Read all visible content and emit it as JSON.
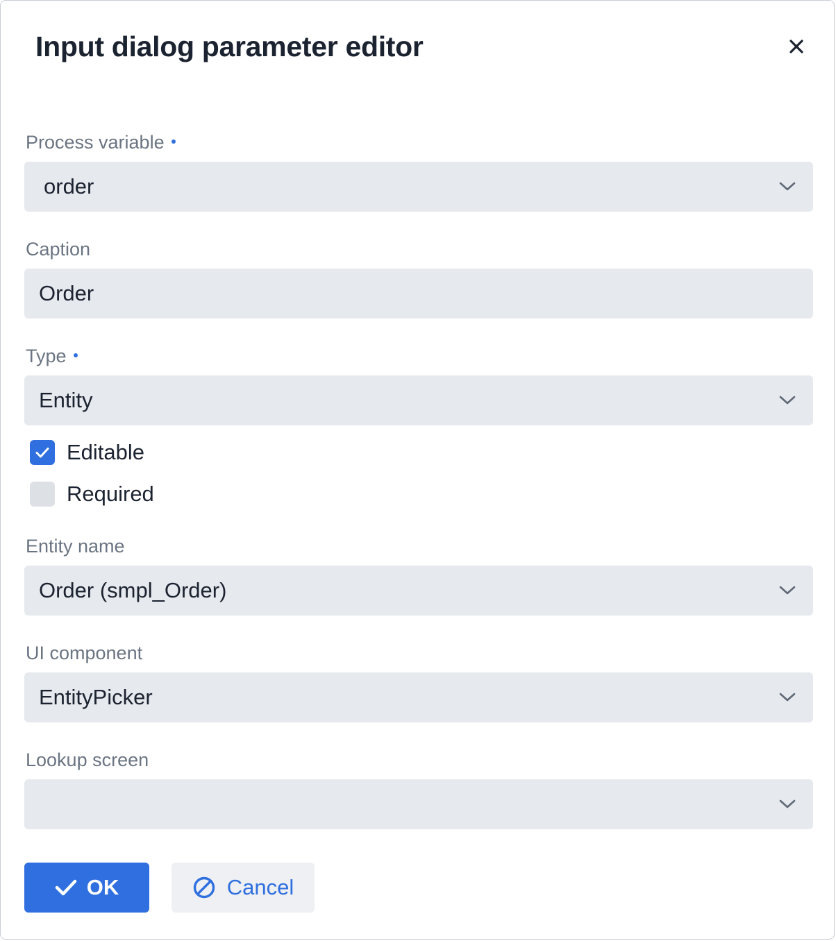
{
  "dialog": {
    "title": "Input dialog parameter editor"
  },
  "fields": {
    "process_variable": {
      "label": "Process variable",
      "value": "order"
    },
    "caption": {
      "label": "Caption",
      "value": "Order"
    },
    "type": {
      "label": "Type",
      "value": "Entity"
    },
    "entity_name": {
      "label": "Entity name",
      "value": "Order (smpl_Order)"
    },
    "ui_component": {
      "label": "UI component",
      "value": "EntityPicker"
    },
    "lookup_screen": {
      "label": "Lookup screen",
      "value": ""
    }
  },
  "checkboxes": {
    "editable": {
      "label": "Editable",
      "checked": true
    },
    "required": {
      "label": "Required",
      "checked": false
    }
  },
  "buttons": {
    "ok_label": "OK",
    "cancel_label": "Cancel"
  },
  "colors": {
    "accent": "#2f6fe0",
    "field_bg": "#e6e9ed",
    "label_text": "#6b7482",
    "body_text": "#1c2330"
  },
  "icons": {
    "close": "close-icon",
    "chevron": "chevron-down-icon",
    "check": "check-icon",
    "cancel": "ban-icon"
  }
}
